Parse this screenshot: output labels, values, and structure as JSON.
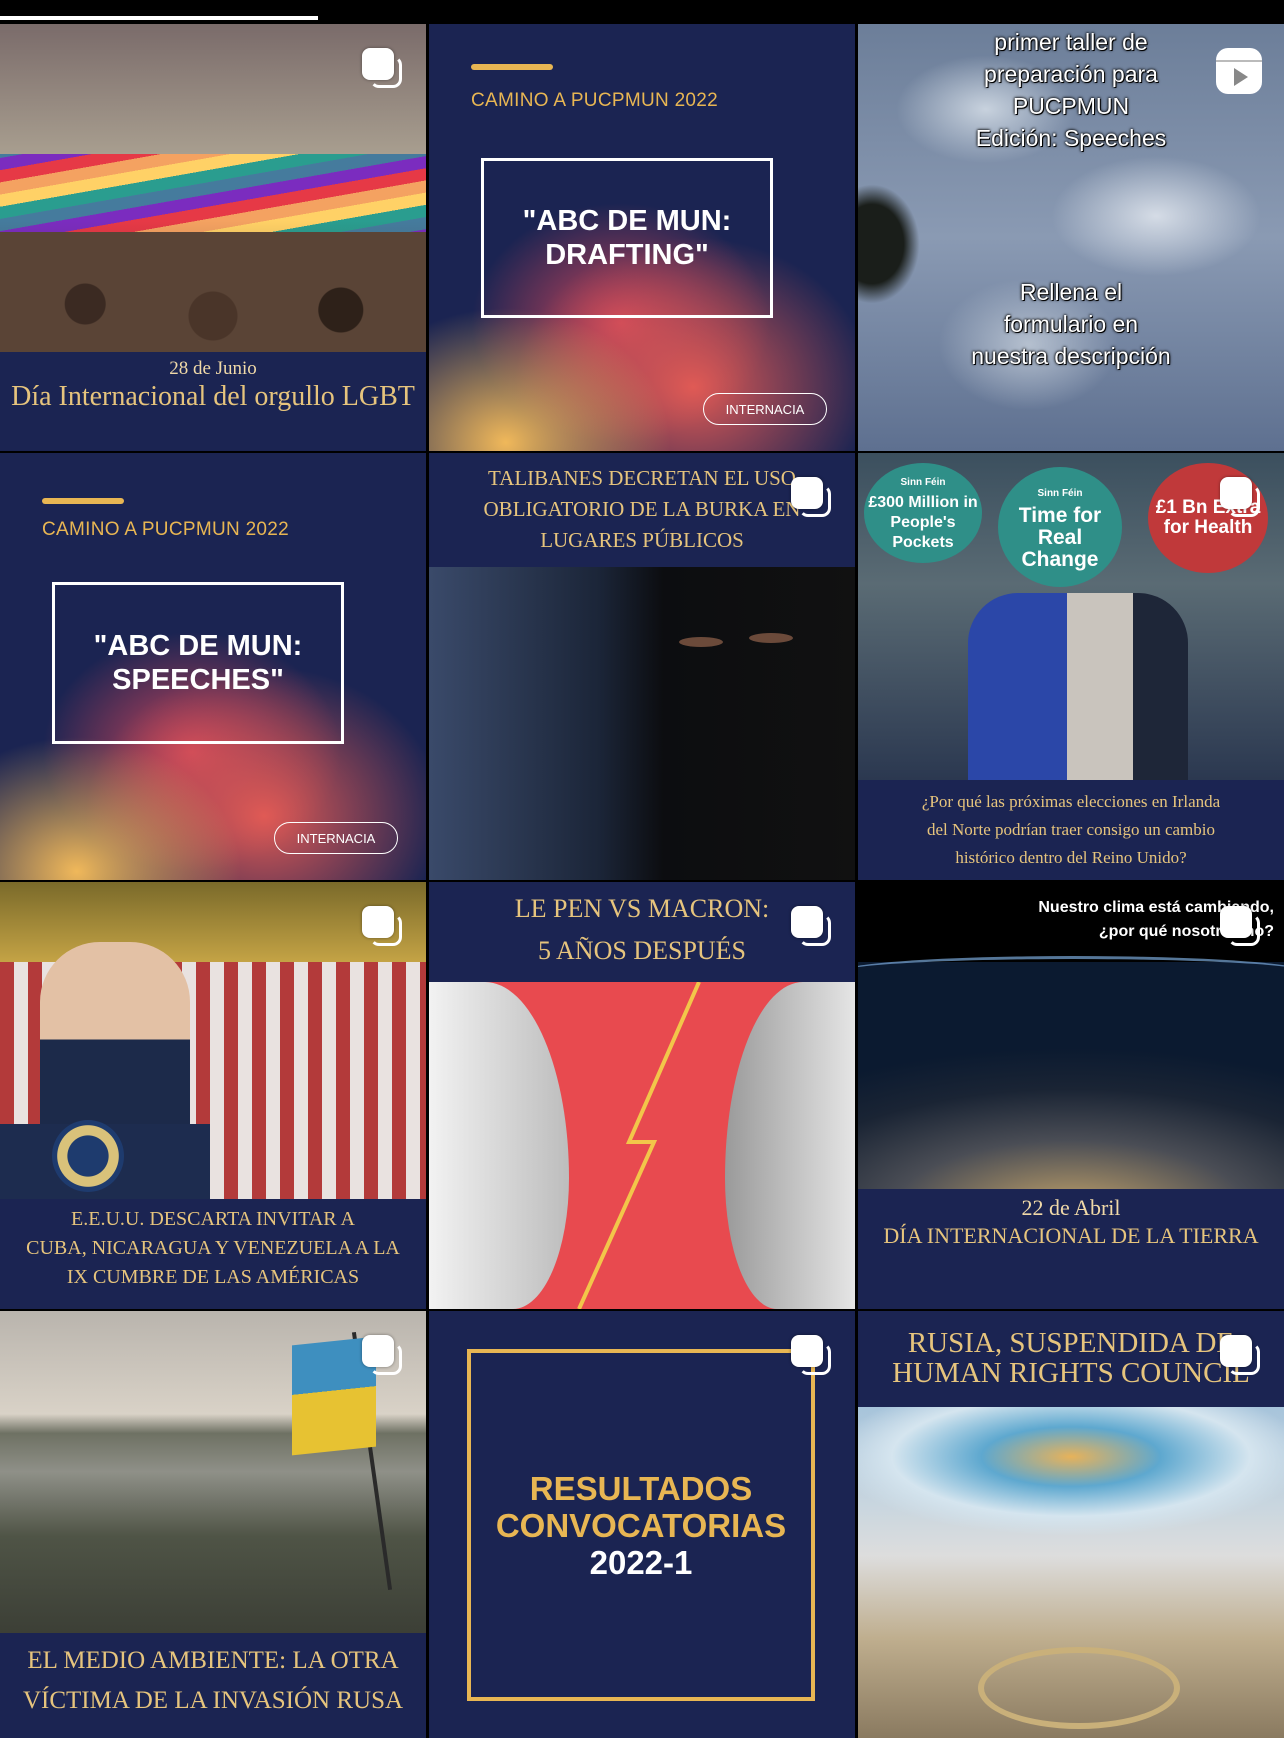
{
  "posts": {
    "pride": {
      "date": "28 de Junio",
      "title": "Día Internacional del orgullo LGBT"
    },
    "drafting": {
      "kicker": "CAMINO A PUCPMUN 2022",
      "title_l1": "\"ABC DE MUN:",
      "title_l2": "DRAFTING\"",
      "pill": "INTERNACIA"
    },
    "reel": {
      "top_l1": "primer taller de",
      "top_l2": "preparación para",
      "top_l3": "PUCPMUN",
      "top_l4": "Edición: Speeches",
      "bot_l1": "Rellena el",
      "bot_l2": "formulario en",
      "bot_l3": "nuestra descripción"
    },
    "speeches": {
      "kicker": "CAMINO A PUCPMUN 2022",
      "title_l1": "\"ABC DE MUN:",
      "title_l2": "SPEECHES\"",
      "pill": "INTERNACIA"
    },
    "burka": {
      "l1": "TALIBANES DECRETAN EL USO",
      "l2": "OBLIGATORIO DE LA BURKA EN",
      "l3": "LUGARES PÚBLICOS"
    },
    "sinnfein": {
      "sign1_brand": "Sinn Féin",
      "sign1": "£300 Million in People's Pockets",
      "sign2_brand": "Sinn Féin",
      "sign2": "Time for Real Change",
      "sign3": "£1 Bn Extra for Health",
      "cap_l1": "¿Por qué las próximas elecciones en Irlanda",
      "cap_l2": "del Norte podrían traer consigo un cambio",
      "cap_l3": "histórico dentro del Reino Unido?"
    },
    "biden": {
      "l1": "E.E.U.U. DESCARTA INVITAR A",
      "l2": "CUBA, NICARAGUA Y VENEZUELA A LA",
      "l3": "IX CUMBRE DE LAS AMÉRICAS"
    },
    "lepen": {
      "l1": "LE PEN VS MACRON:",
      "l2": "5 AÑOS DESPUÉS"
    },
    "earth": {
      "top_l1": "Nuestro clima está cambiando,",
      "top_l2": "¿por qué nosotros no?",
      "date": "22 de Abril",
      "title": "DÍA INTERNACIONAL DE LA TIERRA"
    },
    "ukraine": {
      "l1": "EL MEDIO AMBIENTE: LA OTRA",
      "l2": "VÍCTIMA DE LA INVASIÓN RUSA"
    },
    "resultados": {
      "l1": "RESULTADOS",
      "l2": "CONVOCATORIAS",
      "l3": "2022-1"
    },
    "russia": {
      "l1": "RUSIA, SUSPENDIDA DE",
      "l2": "HUMAN RIGHTS COUNCIL"
    }
  },
  "icons": {
    "carousel": "carousel-icon",
    "reel": "reel-icon"
  },
  "colors": {
    "navy": "#1b2452",
    "gold": "#e6c47d",
    "accent": "#e8b653"
  }
}
